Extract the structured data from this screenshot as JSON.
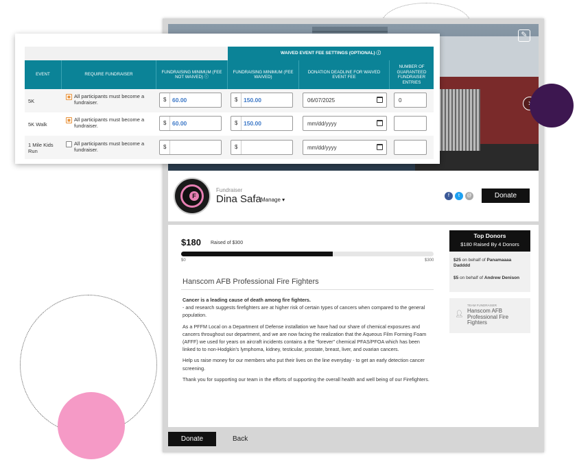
{
  "settings": {
    "group_header": "WAIVED EVENT FEE SETTINGS (OPTIONAL)",
    "columns": [
      "EVENT",
      "REQUIRE FUNDRAISER",
      "FUNDRAISING MINIMUM (FEE NOT WAIVED)",
      "FUNDRAISING MINIMUM (FEE WAIVED)",
      "DONATION DEADLINE FOR WAIVED EVENT FEE",
      "NUMBER OF GUARANTEED FUNDRAISER ENTRIES"
    ],
    "info_icon": "ⓘ",
    "currency_symbol": "$",
    "accent_color": "#0b8397",
    "rows": [
      {
        "event": "5K",
        "require_checked": true,
        "require_label": "All participants must become a fundraiser.",
        "min_not_waived": "60.00",
        "min_waived": "150.00",
        "deadline": "06/07/2025",
        "entries": "0"
      },
      {
        "event": "5K Walk",
        "require_checked": true,
        "require_label": "All participants must become a fundraiser.",
        "min_not_waived": "60.00",
        "min_waived": "150.00",
        "deadline": "mm/dd/yyyy",
        "entries": ""
      },
      {
        "event": "1 Mile Kids Run",
        "require_checked": false,
        "require_label": "All participants must become a fundraiser.",
        "min_not_waived": "",
        "min_waived": "",
        "deadline": "mm/dd/yyyy",
        "entries": ""
      }
    ]
  },
  "profile": {
    "role_label": "Fundraiser",
    "name": "Dina Safa",
    "manage_label": "Manage ▾",
    "donate_label": "Donate",
    "avatar_letter": "F",
    "social_icons": [
      "facebook-icon",
      "twitter-icon",
      "email-icon"
    ]
  },
  "progress": {
    "raised": "$180",
    "raised_of": "Raised of $300",
    "min_label": "$0",
    "max_label": "$300",
    "fraction": 0.6
  },
  "story": {
    "title": "Hanscom AFB Professional Fire Fighters",
    "lead": "Cancer is a leading cause of death among fire fighters.",
    "p1": "- and research suggests firefighters are at higher risk of certain types of cancers when compared to the general population.",
    "p2": "As a PFFM Local on a Department of Defense installation we have had our share of chemical exposures and cancers throughout our department, and we are now facing the realization that the Aqueous Film Forming Foam (AFFF) we used for years on aircraft incidents contains a the \"forever\" chemical PFAS/PFOA which has been linked to to non-Hodgkin's lymphoma, kidney, testicular, prostate, breast, liver, and ovarian cancers.",
    "p3": "Help us raise money for our members who put their lives on the line everyday - to get an early detection cancer screening.",
    "p4": "Thank you for supporting our team in the efforts of supporting the overall health and well being of our Firefighters."
  },
  "top_donors": {
    "title": "Top Donors",
    "subtitle": "$180 Raised By 4 Donors",
    "donors": [
      {
        "amount": "$25",
        "on_behalf": "on behalf of",
        "name": "Panamaaaa Dadddd"
      },
      {
        "amount": "$5",
        "on_behalf": "on behalf of",
        "name": "Andrew Denison"
      }
    ]
  },
  "team_card": {
    "label": "TEAM FUNDRAISER",
    "name": "Hanscom AFB Professional Fire Fighters"
  },
  "bottom": {
    "donate_label": "Donate",
    "back_label": "Back"
  }
}
